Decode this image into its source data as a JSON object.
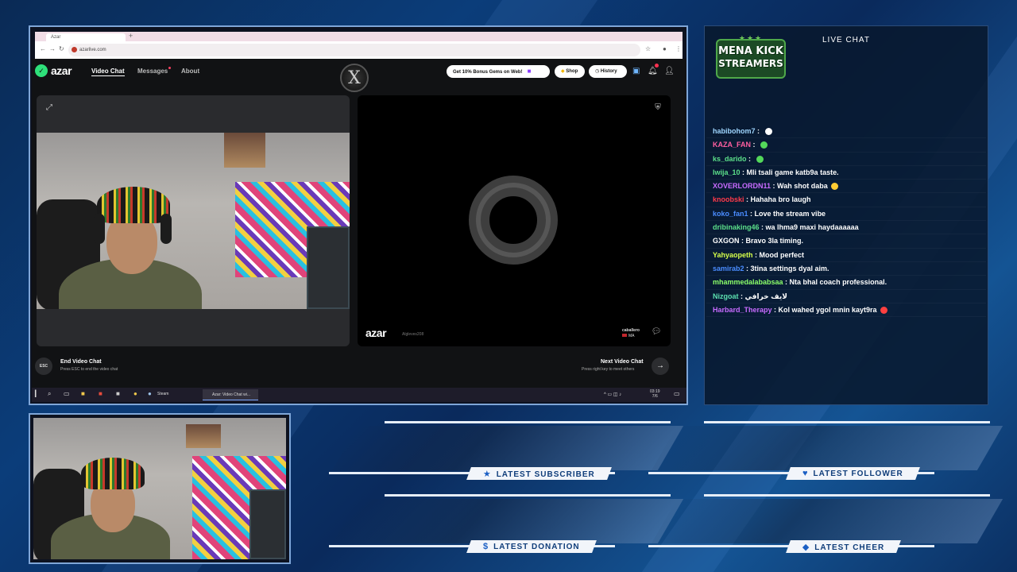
{
  "browser": {
    "tab_label": "Azar",
    "url": "azarlive.com"
  },
  "azar": {
    "logo_text": "azar",
    "nav": {
      "video_chat": "Video Chat",
      "messages": "Messages",
      "about": "About"
    },
    "center_logo": "X",
    "header_buttons": {
      "gems": "Get 10% Bonus Gems on Web!",
      "shop": "Shop",
      "history": "History"
    },
    "remote": {
      "watermark": "azar",
      "user_id": "Algleves208",
      "name": "caballero",
      "country": "MA"
    },
    "footer": {
      "esc_label": "ESC",
      "end_title": "End Video Chat",
      "end_sub": "Press ESC to end the video chat",
      "next_title": "Next Video Chat",
      "next_sub": "Press right key to meet others",
      "next_icon": "→"
    }
  },
  "taskbar": {
    "steam_label": "Steam",
    "chrome_label": "Azar: Video Chat wi...",
    "clock_time": "03:19",
    "clock_date": "7/6"
  },
  "chat": {
    "logo_line1": "MENA KICK",
    "logo_line2": "STREAMERS",
    "title": "LIVE CHAT",
    "messages": [
      {
        "user": "habibohom7",
        "text": "",
        "color": "#9fd6ff",
        "emoji": "#ffffff"
      },
      {
        "user": "KAZA_FAN",
        "text": "",
        "color": "#ff5fa0",
        "emoji": "#53d85a"
      },
      {
        "user": "ks_darido",
        "text": "",
        "color": "#5ce08a",
        "emoji": "#53d85a"
      },
      {
        "user": "lwija_10",
        "text": "Mli tsali game katb9a taste.",
        "color": "#5ce08a",
        "emoji": ""
      },
      {
        "user": "XOVERLORDN11",
        "text": "Wah shot daba",
        "color": "#c86bff",
        "emoji": "#ffcc33"
      },
      {
        "user": "knoobski",
        "text": "Hahaha bro laugh",
        "color": "#ff3a4a",
        "emoji": ""
      },
      {
        "user": "koko_fan1",
        "text": "Love the stream vibe",
        "color": "#4a8cff",
        "emoji": ""
      },
      {
        "user": "dribinaking46",
        "text": "wa lhma9 maxi haydaaaaaa",
        "color": "#5ce08a",
        "emoji": ""
      },
      {
        "user": "GXGON",
        "text": "Bravo 3la timing.",
        "color": "#ffffff",
        "emoji": ""
      },
      {
        "user": "Yahyaopeth",
        "text": "Mood perfect",
        "color": "#d6ff4a",
        "emoji": ""
      },
      {
        "user": "samirab2",
        "text": "3tina settings dyal aim.",
        "color": "#4a8cff",
        "emoji": ""
      },
      {
        "user": "mhammedalababsaa",
        "text": "Nta bhal coach professional.",
        "color": "#8cff6a",
        "emoji": ""
      },
      {
        "user": "Nizgoat",
        "text": "لايف خرافي",
        "color": "#5ce0b0",
        "emoji": ""
      },
      {
        "user": "Harbard_Therapy",
        "text": "Kol wahed ygol mnin kayt9ra",
        "color": "#c86bff",
        "emoji": "#ff4040"
      }
    ]
  },
  "alerts": {
    "subscriber": "LATEST SUBSCRIBER",
    "follower": "LATEST FOLLOWER",
    "donation": "LATEST DONATION",
    "cheer": "LATEST CHEER"
  }
}
